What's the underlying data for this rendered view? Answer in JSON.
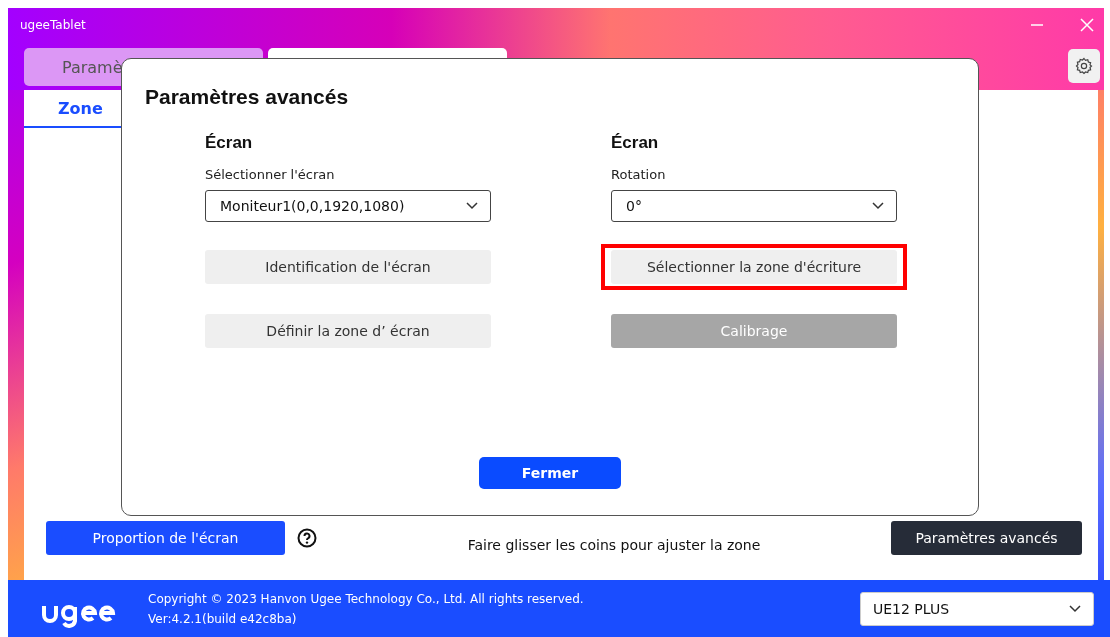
{
  "window": {
    "title": "ugeeTablet"
  },
  "tabs": [
    {
      "label": "Paramè",
      "selected": true
    },
    {
      "selected": false
    }
  ],
  "subtabs": [
    {
      "label": "Zone",
      "selected": true
    }
  ],
  "bottom_bar": {
    "ratio_button": "Proportion de l'écran",
    "hint": "Faire glisser les coins pour ajuster la zone",
    "advanced_button": "Paramètres avancés"
  },
  "footer": {
    "copyright": "Copyright © 2023 Hanvon Ugee Technology Co., Ltd. All rights reserved.",
    "version": "Ver:4.2.1(build e42c8ba)",
    "device": "UE12 PLUS"
  },
  "dialog": {
    "title": "Paramètres avancés",
    "columns": [
      {
        "heading": "Écran",
        "field_label": "Sélectionner l'écran",
        "value": "Moniteur1(0,0,1920,1080)",
        "buttons": [
          {
            "label": "Identification de l'écran",
            "disabled": false,
            "highlighted": false
          },
          {
            "label": "Définir la zone d’  écran",
            "disabled": false,
            "highlighted": false
          }
        ]
      },
      {
        "heading": "Écran",
        "field_label": "Rotation",
        "value": "0°",
        "buttons": [
          {
            "label": "Sélectionner la zone d'écriture",
            "disabled": false,
            "highlighted": true
          },
          {
            "label": "Calibrage",
            "disabled": true,
            "highlighted": false
          }
        ]
      }
    ],
    "close_button": "Fermer"
  }
}
